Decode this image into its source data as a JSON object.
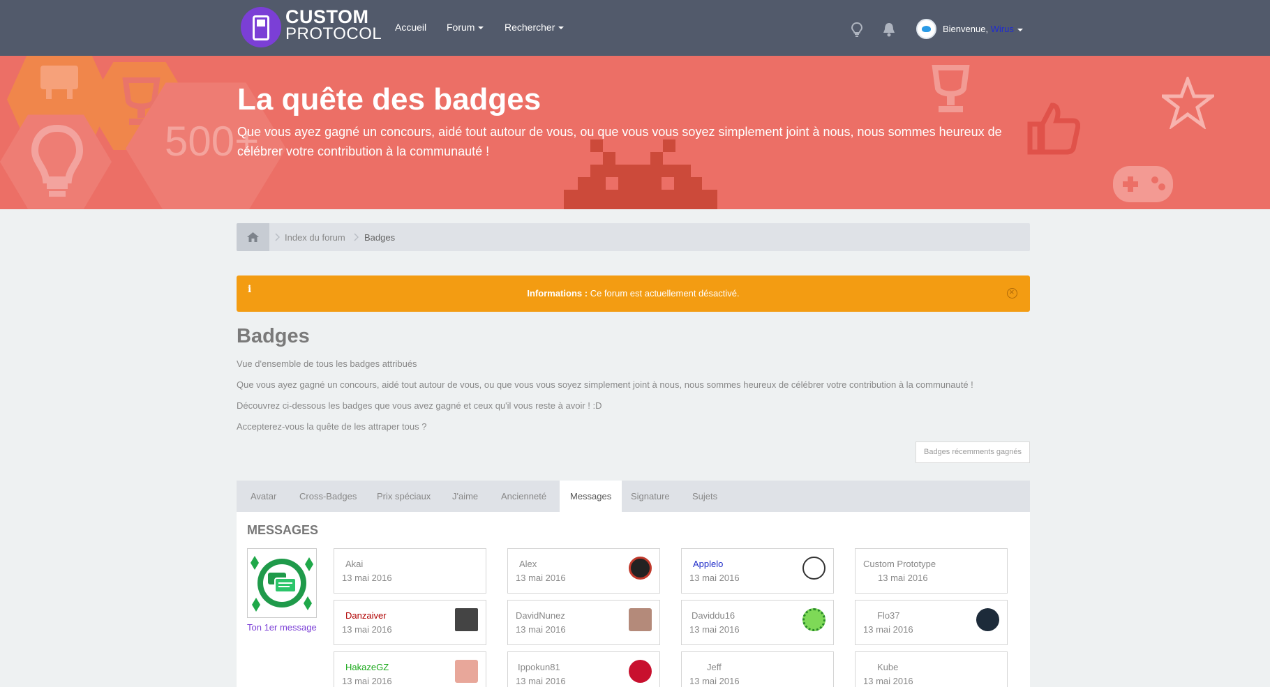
{
  "header": {
    "logo_line1": "CUSTOM",
    "logo_line2": "PROTOCOL",
    "nav": [
      {
        "label": "Accueil"
      },
      {
        "label": "Forum"
      },
      {
        "label": "Rechercher"
      }
    ],
    "welcome_prefix": "Bienvenue, ",
    "username": "Wirus"
  },
  "hero": {
    "title": "La quête des badges",
    "subtitle": "Que vous ayez gagné un concours, aidé tout autour de vous, ou que vous vous soyez simplement joint à nous, nous sommes heureux de célébrer votre contribution à la communauté !",
    "bg_number": "500+"
  },
  "breadcrumb": {
    "items": [
      "Index du forum",
      "Badges"
    ]
  },
  "alert": {
    "icon": "i",
    "label": "Informations :",
    "text": " Ce forum est actuellement désactivé."
  },
  "page": {
    "title": "Badges",
    "paragraphs": [
      "Vue d'ensemble de tous les badges attribués",
      "Que vous ayez gagné un concours, aidé tout autour de vous, ou que vous vous soyez simplement joint à nous, nous sommes heureux de célébrer votre contribution à la communauté !",
      "Découvrez ci-dessous les badges que vous avez gagné et ceux qu'il vous reste à avoir ! :D",
      "Accepterez-vous la quête de les attraper tous ?"
    ],
    "recent_button": "Badges récemments gagnés"
  },
  "tabs": [
    "Avatar",
    "Cross-Badges",
    "Prix spéciaux",
    "J'aime",
    "Ancienneté",
    "Messages",
    "Signature",
    "Sujets"
  ],
  "active_tab": "Messages",
  "section": {
    "heading": "MESSAGES",
    "badge_caption": "Ton 1er message"
  },
  "users": [
    {
      "name": "Akai",
      "date": "13 mai 2016"
    },
    {
      "name": "Alex",
      "date": "13 mai 2016"
    },
    {
      "name": "Applelo",
      "date": "13 mai 2016"
    },
    {
      "name": "Custom Prototype",
      "date": "13 mai 2016"
    },
    {
      "name": "Danzaiver",
      "date": "13 mai 2016"
    },
    {
      "name": "DavidNunez",
      "date": "13 mai 2016"
    },
    {
      "name": "Daviddu16",
      "date": "13 mai 2016"
    },
    {
      "name": "Flo37",
      "date": "13 mai 2016"
    },
    {
      "name": "HakazeGZ",
      "date": "13 mai 2016"
    },
    {
      "name": "Ippokun81",
      "date": "13 mai 2016"
    },
    {
      "name": "Jeff",
      "date": "13 mai 2016"
    },
    {
      "name": "Kube",
      "date": "13 mai 2016"
    }
  ],
  "colors": {
    "navbar": "#525a6b",
    "hero": "#ec6f66",
    "alert": "#f39c12",
    "link_purple": "#7b3fd6",
    "name_blue": "#1e2bc8",
    "name_red": "#b00000",
    "name_green": "#1aa81a"
  }
}
